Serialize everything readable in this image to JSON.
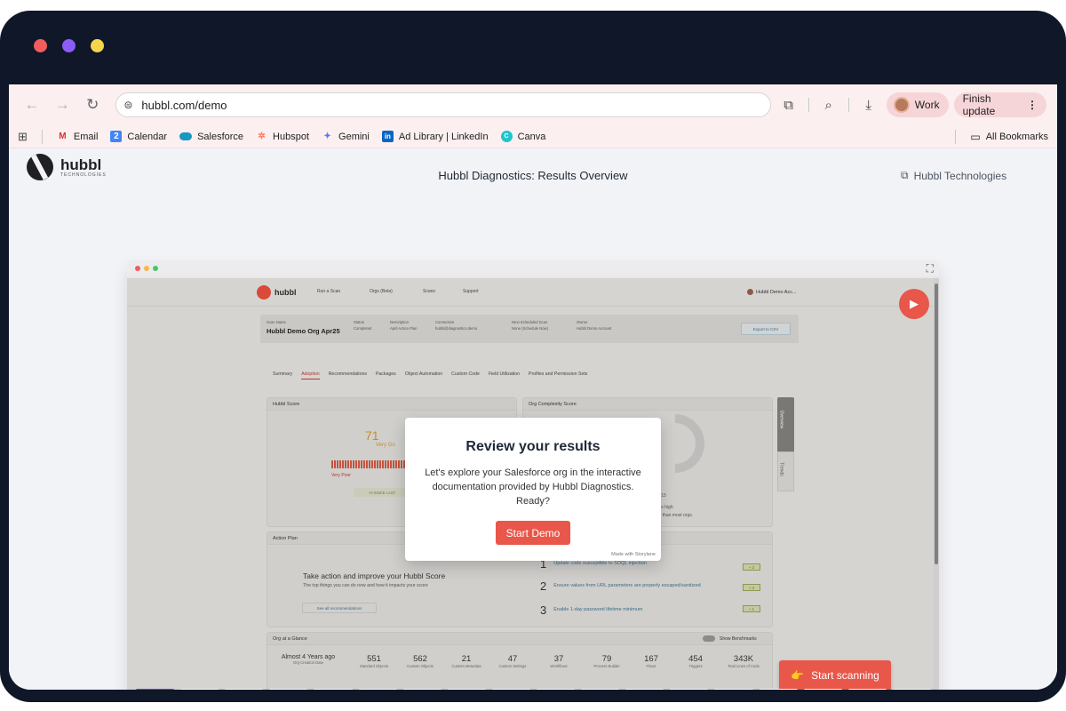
{
  "browser": {
    "url": "hubbl.com/demo",
    "profile": "Work",
    "update_label": "Finish update",
    "bookmarks": [
      {
        "label": "Email",
        "icon": "gmail-icon"
      },
      {
        "label": "Calendar",
        "icon": "calendar-icon"
      },
      {
        "label": "Salesforce",
        "icon": "salesforce-icon"
      },
      {
        "label": "Hubspot",
        "icon": "hubspot-icon"
      },
      {
        "label": "Gemini",
        "icon": "gemini-icon"
      },
      {
        "label": "Ad Library | LinkedIn",
        "icon": "linkedin-icon"
      },
      {
        "label": "Canva",
        "icon": "canva-icon"
      }
    ],
    "all_bookmarks": "All Bookmarks"
  },
  "page": {
    "brand": "hubbl",
    "brand_sub": "TECHNOLOGIES",
    "title": "Hubbl Diagnostics: Results Overview",
    "external_link": "Hubbl Technologies"
  },
  "app": {
    "nav": [
      "Run a Scan",
      "Orgs (Beta)",
      "Scans",
      "Support"
    ],
    "account": "Hubbl Demo Acc...",
    "scan": {
      "scan_name_label": "Scan Name",
      "scan_name": "Hubbl Demo Org Apr25",
      "status_label": "Status",
      "status": "Completed",
      "description_label": "Description",
      "description": "April Action Plan",
      "connection_label": "Connection",
      "connection": "hubbl@diagnostics.demo",
      "next_scan_label": "Next Scheduled Scan",
      "next_scan": "None (Schedule Now)",
      "owner_label": "Owner",
      "owner": "Hubbl Demo Account",
      "export": "Export to CSV"
    },
    "tabs": [
      "Summary",
      "Adoption",
      "Recommendations",
      "Packages",
      "Object Automation",
      "Custom Code",
      "Field Utilization",
      "Profiles and Permission Sets"
    ],
    "hubbl_score": {
      "title": "Hubbl Score",
      "value": "71",
      "rating": "Very Go",
      "poor": "Very Poor",
      "since": "+0 SINCE LAST"
    },
    "complexity": {
      "title": "Org Complexity Score",
      "line1": "k: 15",
      "line2": "e is high",
      "line3": "ex than most orgs."
    },
    "side_tabs": [
      "Overview",
      "Trends"
    ],
    "action_plan": {
      "title": "Action Plan",
      "heading": "Take action and improve your Hubbl Score",
      "desc": "The top things you can do now and how it impacts your score",
      "link": "See all recommendations",
      "items": [
        {
          "n": "1",
          "text": "Update code susceptible to SOQL injection",
          "badge": "+ 3"
        },
        {
          "n": "2",
          "text": "Ensure values from URL parameters are properly escaped/sanitized",
          "badge": "+ 3"
        },
        {
          "n": "3",
          "text": "Enable 1-day password lifetime minimum",
          "badge": "+ 1"
        }
      ]
    },
    "glance": {
      "title": "Org at a Glance",
      "toggle_label": "Show Benchmarks",
      "items": [
        {
          "v": "Almost 4 Years ago",
          "l": "Org Creation Date"
        },
        {
          "v": "551",
          "l": "Standard Objects"
        },
        {
          "v": "562",
          "l": "Custom Objects"
        },
        {
          "v": "21",
          "l": "Custom Metadata"
        },
        {
          "v": "47",
          "l": "Custom Settings"
        },
        {
          "v": "37",
          "l": "Workflows"
        },
        {
          "v": "79",
          "l": "Process Builder"
        },
        {
          "v": "167",
          "l": "Flows"
        },
        {
          "v": "454",
          "l": "Triggers"
        },
        {
          "v": "343K",
          "l": "Total Lines of Code"
        }
      ]
    }
  },
  "modal": {
    "title": "Review your results",
    "body": "Let's explore your Salesforce org in the interactive documentation provided by Hubbl Diagnostics. Ready?",
    "button": "Start Demo",
    "made_with": "Made with Storylane"
  },
  "cta": {
    "label": "Start scanning",
    "icon": "pointing-hand-icon"
  },
  "progress": {
    "segments": 18,
    "active": 1
  },
  "colors": {
    "accent": "#e8574a",
    "progress_active": "#7c3aed",
    "frame": "#0f1729"
  }
}
